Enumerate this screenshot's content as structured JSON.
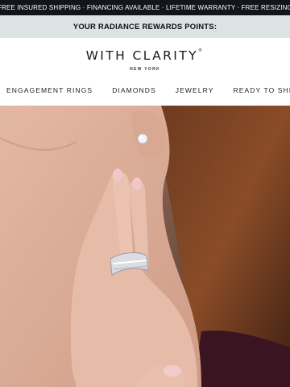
{
  "promo_bar": {
    "text": "FREE INSURED SHIPPING · FINANCING AVAILABLE · LIFETIME WARRANTY · FREE RESIZING"
  },
  "rewards_bar": {
    "text": "YOUR RADIANCE REWARDS POINTS:"
  },
  "brand": {
    "name": "WITH CLARITY",
    "trademark": "®",
    "location": "NEW YORK"
  },
  "nav": {
    "items": [
      {
        "label": "ENGAGEMENT RINGS"
      },
      {
        "label": "DIAMONDS"
      },
      {
        "label": "JEWELRY"
      },
      {
        "label": "READY TO SHIP"
      }
    ]
  },
  "hero": {
    "icon": "hero-image-woman-with-ring-and-earring"
  },
  "colors": {
    "promo_bg": "#14141d",
    "rewards_bg": "#dbe3e3",
    "text": "#1a1a1a"
  }
}
